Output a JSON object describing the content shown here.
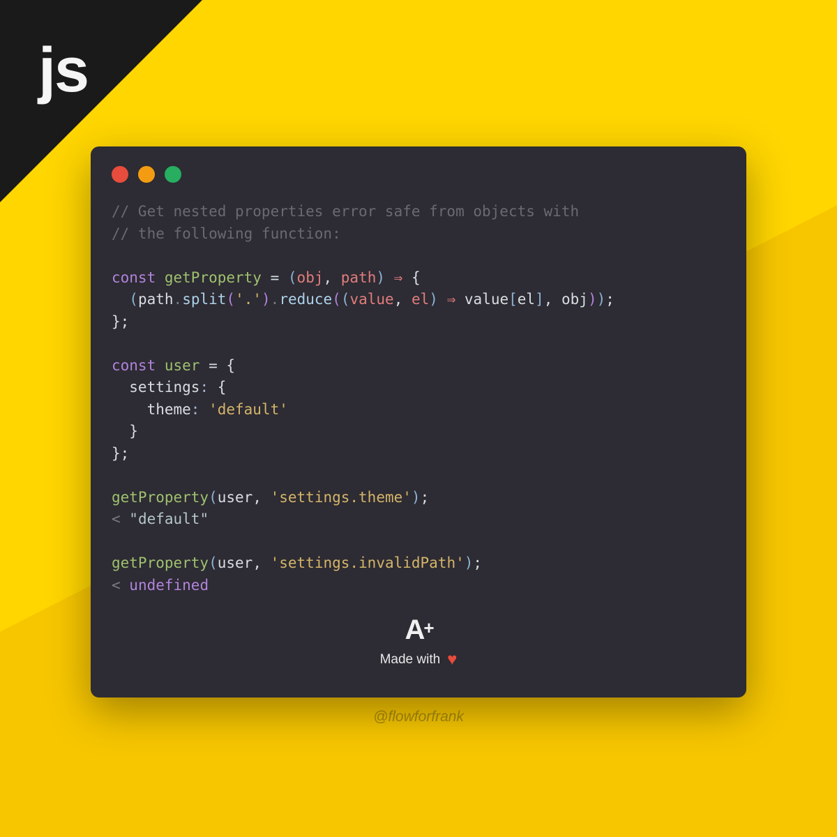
{
  "corner": {
    "label": "js"
  },
  "window": {
    "dots": [
      "red",
      "yellow",
      "green"
    ]
  },
  "code": {
    "comment1": "// Get nested properties error safe from objects with",
    "comment2": "// the following function:",
    "l1_const": "const",
    "l1_func": "getProperty",
    "l1_eq": " = ",
    "l1_po": "(",
    "l1_obj": "obj",
    "l1_comma": ", ",
    "l1_path": "path",
    "l1_pc": ")",
    "l1_arrow": " ⇒ ",
    "l1_brace": "{",
    "l2_indent": "  ",
    "l2_po": "(",
    "l2_path": "path",
    "l2_dot1": ".",
    "l2_split": "split",
    "l2_spo": "(",
    "l2_dotstr": "'.'",
    "l2_spc": ")",
    "l2_dot2": ".",
    "l2_reduce": "reduce",
    "l2_rpo": "(",
    "l2_ipo": "(",
    "l2_value": "value",
    "l2_ic": ", ",
    "l2_el": "el",
    "l2_ipc": ")",
    "l2_arrow": " ⇒ ",
    "l2_value2": "value",
    "l2_bro": "[",
    "l2_el2": "el",
    "l2_brc": "]",
    "l2_rc": ", ",
    "l2_obj": "obj",
    "l2_rpc": ")",
    "l2_pc": ")",
    "l2_semi": ";",
    "l3": "};",
    "l5_const": "const",
    "l5_user": "user",
    "l5_eq": " = {",
    "l6": "  settings",
    "l6_colon": ": ",
    "l6_brace": "{",
    "l7": "    theme",
    "l7_colon": ": ",
    "l7_val": "'default'",
    "l8": "  }",
    "l9": "};",
    "l11_fn": "getProperty",
    "l11_po": "(",
    "l11_user": "user",
    "l11_c": ", ",
    "l11_str": "'settings.theme'",
    "l11_pc": ")",
    "l11_semi": ";",
    "l12_caret": "< ",
    "l12_val": "\"default\"",
    "l14_fn": "getProperty",
    "l14_po": "(",
    "l14_user": "user",
    "l14_c": ", ",
    "l14_str": "'settings.invalidPath'",
    "l14_pc": ")",
    "l14_semi": ";",
    "l15_caret": "< ",
    "l15_val": "undefined"
  },
  "footer": {
    "logo_a": "A",
    "logo_plus": "+",
    "made_with": "Made with",
    "heart": "♥"
  },
  "handle": "@flowforfrank"
}
